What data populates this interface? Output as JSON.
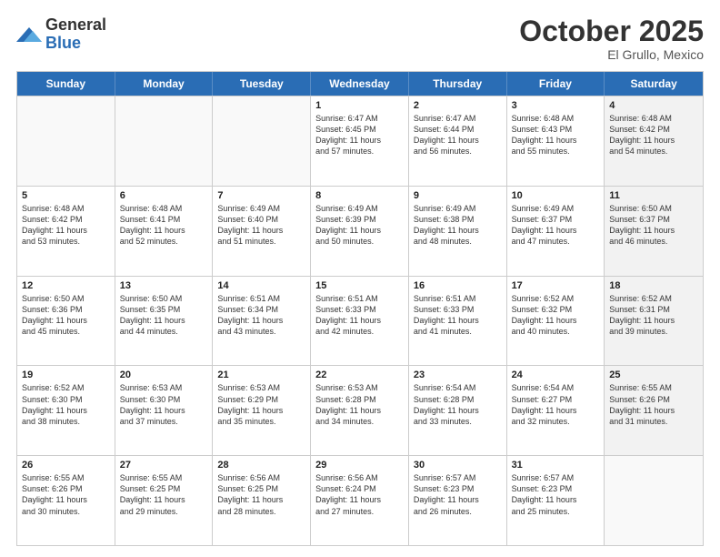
{
  "logo": {
    "general": "General",
    "blue": "Blue"
  },
  "title": "October 2025",
  "location": "El Grullo, Mexico",
  "header": {
    "days": [
      "Sunday",
      "Monday",
      "Tuesday",
      "Wednesday",
      "Thursday",
      "Friday",
      "Saturday"
    ]
  },
  "rows": [
    [
      {
        "day": "",
        "text": ""
      },
      {
        "day": "",
        "text": ""
      },
      {
        "day": "",
        "text": ""
      },
      {
        "day": "1",
        "text": "Sunrise: 6:47 AM\nSunset: 6:45 PM\nDaylight: 11 hours\nand 57 minutes."
      },
      {
        "day": "2",
        "text": "Sunrise: 6:47 AM\nSunset: 6:44 PM\nDaylight: 11 hours\nand 56 minutes."
      },
      {
        "day": "3",
        "text": "Sunrise: 6:48 AM\nSunset: 6:43 PM\nDaylight: 11 hours\nand 55 minutes."
      },
      {
        "day": "4",
        "text": "Sunrise: 6:48 AM\nSunset: 6:42 PM\nDaylight: 11 hours\nand 54 minutes."
      }
    ],
    [
      {
        "day": "5",
        "text": "Sunrise: 6:48 AM\nSunset: 6:42 PM\nDaylight: 11 hours\nand 53 minutes."
      },
      {
        "day": "6",
        "text": "Sunrise: 6:48 AM\nSunset: 6:41 PM\nDaylight: 11 hours\nand 52 minutes."
      },
      {
        "day": "7",
        "text": "Sunrise: 6:49 AM\nSunset: 6:40 PM\nDaylight: 11 hours\nand 51 minutes."
      },
      {
        "day": "8",
        "text": "Sunrise: 6:49 AM\nSunset: 6:39 PM\nDaylight: 11 hours\nand 50 minutes."
      },
      {
        "day": "9",
        "text": "Sunrise: 6:49 AM\nSunset: 6:38 PM\nDaylight: 11 hours\nand 48 minutes."
      },
      {
        "day": "10",
        "text": "Sunrise: 6:49 AM\nSunset: 6:37 PM\nDaylight: 11 hours\nand 47 minutes."
      },
      {
        "day": "11",
        "text": "Sunrise: 6:50 AM\nSunset: 6:37 PM\nDaylight: 11 hours\nand 46 minutes."
      }
    ],
    [
      {
        "day": "12",
        "text": "Sunrise: 6:50 AM\nSunset: 6:36 PM\nDaylight: 11 hours\nand 45 minutes."
      },
      {
        "day": "13",
        "text": "Sunrise: 6:50 AM\nSunset: 6:35 PM\nDaylight: 11 hours\nand 44 minutes."
      },
      {
        "day": "14",
        "text": "Sunrise: 6:51 AM\nSunset: 6:34 PM\nDaylight: 11 hours\nand 43 minutes."
      },
      {
        "day": "15",
        "text": "Sunrise: 6:51 AM\nSunset: 6:33 PM\nDaylight: 11 hours\nand 42 minutes."
      },
      {
        "day": "16",
        "text": "Sunrise: 6:51 AM\nSunset: 6:33 PM\nDaylight: 11 hours\nand 41 minutes."
      },
      {
        "day": "17",
        "text": "Sunrise: 6:52 AM\nSunset: 6:32 PM\nDaylight: 11 hours\nand 40 minutes."
      },
      {
        "day": "18",
        "text": "Sunrise: 6:52 AM\nSunset: 6:31 PM\nDaylight: 11 hours\nand 39 minutes."
      }
    ],
    [
      {
        "day": "19",
        "text": "Sunrise: 6:52 AM\nSunset: 6:30 PM\nDaylight: 11 hours\nand 38 minutes."
      },
      {
        "day": "20",
        "text": "Sunrise: 6:53 AM\nSunset: 6:30 PM\nDaylight: 11 hours\nand 37 minutes."
      },
      {
        "day": "21",
        "text": "Sunrise: 6:53 AM\nSunset: 6:29 PM\nDaylight: 11 hours\nand 35 minutes."
      },
      {
        "day": "22",
        "text": "Sunrise: 6:53 AM\nSunset: 6:28 PM\nDaylight: 11 hours\nand 34 minutes."
      },
      {
        "day": "23",
        "text": "Sunrise: 6:54 AM\nSunset: 6:28 PM\nDaylight: 11 hours\nand 33 minutes."
      },
      {
        "day": "24",
        "text": "Sunrise: 6:54 AM\nSunset: 6:27 PM\nDaylight: 11 hours\nand 32 minutes."
      },
      {
        "day": "25",
        "text": "Sunrise: 6:55 AM\nSunset: 6:26 PM\nDaylight: 11 hours\nand 31 minutes."
      }
    ],
    [
      {
        "day": "26",
        "text": "Sunrise: 6:55 AM\nSunset: 6:26 PM\nDaylight: 11 hours\nand 30 minutes."
      },
      {
        "day": "27",
        "text": "Sunrise: 6:55 AM\nSunset: 6:25 PM\nDaylight: 11 hours\nand 29 minutes."
      },
      {
        "day": "28",
        "text": "Sunrise: 6:56 AM\nSunset: 6:25 PM\nDaylight: 11 hours\nand 28 minutes."
      },
      {
        "day": "29",
        "text": "Sunrise: 6:56 AM\nSunset: 6:24 PM\nDaylight: 11 hours\nand 27 minutes."
      },
      {
        "day": "30",
        "text": "Sunrise: 6:57 AM\nSunset: 6:23 PM\nDaylight: 11 hours\nand 26 minutes."
      },
      {
        "day": "31",
        "text": "Sunrise: 6:57 AM\nSunset: 6:23 PM\nDaylight: 11 hours\nand 25 minutes."
      },
      {
        "day": "",
        "text": ""
      }
    ]
  ]
}
